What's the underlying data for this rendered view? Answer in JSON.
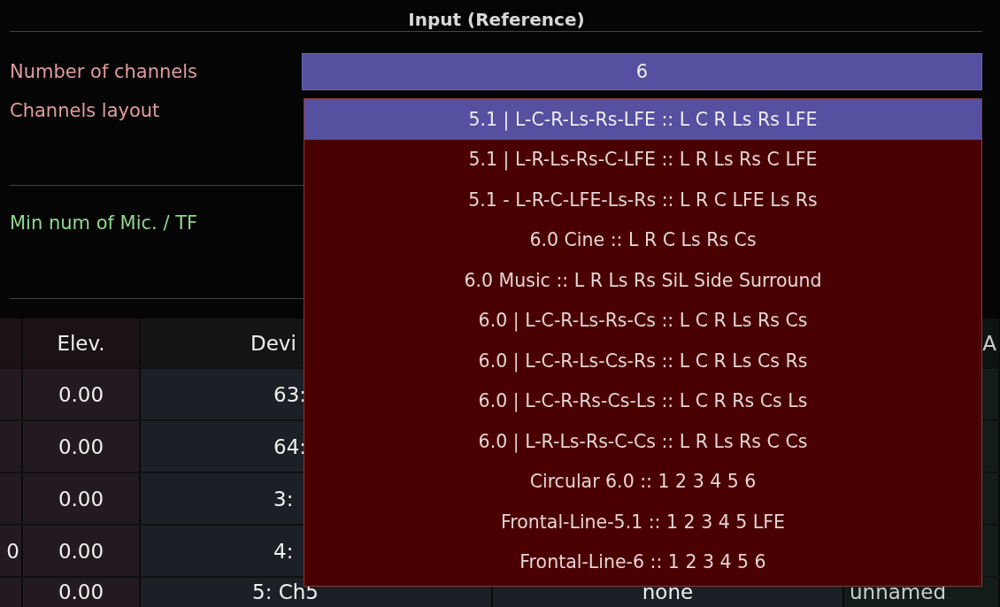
{
  "panel": {
    "title": "Input (Reference)",
    "fields": [
      {
        "kind": "number",
        "label": "Number of channels",
        "value": "6"
      },
      {
        "kind": "dropdown",
        "label": "Channels layout",
        "expanded": true
      },
      {
        "kind": "spacer"
      },
      {
        "kind": "stepper",
        "label": "Min num of Mic. / TF"
      }
    ]
  },
  "dropdown_options": [
    {
      "label": "5.1 | L-C-R-Ls-Rs-LFE :: L C R Ls Rs LFE",
      "selected": true
    },
    {
      "label": "5.1 | L-R-Ls-Rs-C-LFE :: L R Ls Rs C LFE",
      "selected": false
    },
    {
      "label": "5.1 - L-R-C-LFE-Ls-Rs :: L R C LFE Ls Rs",
      "selected": false
    },
    {
      "label": "6.0 Cine :: L R C Ls Rs Cs",
      "selected": false
    },
    {
      "label": "6.0 Music :: L R Ls Rs SiL Side Surround",
      "selected": false
    },
    {
      "label": "6.0 | L-C-R-Ls-Rs-Cs :: L C R Ls Rs Cs",
      "selected": false
    },
    {
      "label": "6.0 | L-C-R-Ls-Cs-Rs :: L C R Ls Cs Rs",
      "selected": false
    },
    {
      "label": "6.0 | L-C-R-Rs-Cs-Ls :: L C R Rs Cs Ls",
      "selected": false
    },
    {
      "label": "6.0 | L-R-Ls-Rs-C-Cs :: L R Ls Rs C Cs",
      "selected": false
    },
    {
      "label": "Circular 6.0 :: 1 2 3 4 5 6",
      "selected": false
    },
    {
      "label": "Frontal-Line-5.1 :: 1 2 3 4 5 LFE",
      "selected": false
    },
    {
      "label": "Frontal-Line-6 :: 1 2 3 4 5 6",
      "selected": false
    }
  ],
  "table": {
    "columns": [
      "",
      "Elev.",
      "Devi",
      "",
      "A"
    ],
    "rows": [
      [
        "",
        "0.00",
        "63:",
        "",
        ""
      ],
      [
        "",
        "0.00",
        "64:",
        "",
        ""
      ],
      [
        "",
        "0.00",
        "3:",
        "",
        ""
      ],
      [
        "0",
        "0.00",
        "4:",
        "",
        ""
      ],
      [
        "",
        "0.00",
        "5: Ch5",
        "none",
        "unnamed"
      ]
    ]
  }
}
